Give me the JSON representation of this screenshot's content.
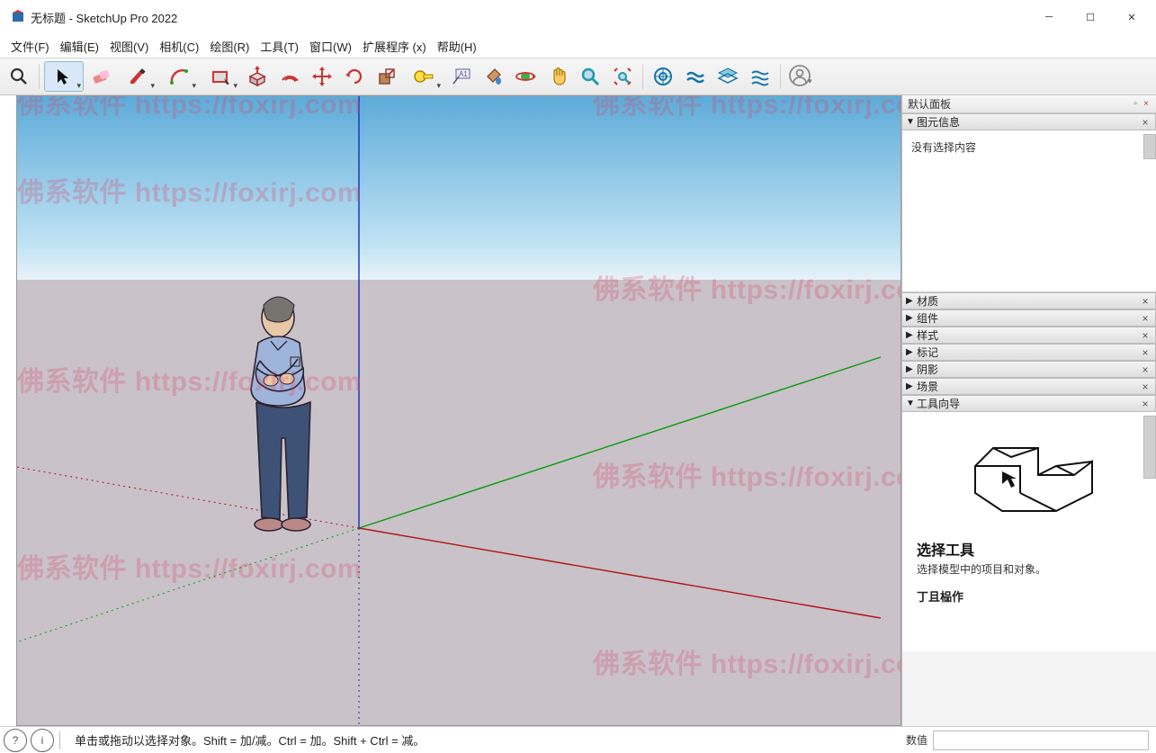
{
  "title": "无标题 - SketchUp Pro 2022",
  "menu": [
    "文件(F)",
    "编辑(E)",
    "视图(V)",
    "相机(C)",
    "绘图(R)",
    "工具(T)",
    "窗口(W)",
    "扩展程序 (x)",
    "帮助(H)"
  ],
  "toolbar": [
    {
      "name": "search-icon"
    },
    {
      "name": "select-tool",
      "active": true,
      "dropdown": true
    },
    {
      "name": "eraser-tool"
    },
    {
      "name": "pencil-tool",
      "dropdown": true
    },
    {
      "name": "arc-tool",
      "dropdown": true
    },
    {
      "name": "rectangle-tool",
      "dropdown": true
    },
    {
      "name": "pushpull-tool"
    },
    {
      "name": "offset-tool"
    },
    {
      "name": "move-tool"
    },
    {
      "name": "rotate-tool"
    },
    {
      "name": "scale-tool"
    },
    {
      "name": "tape-measure-tool",
      "dropdown": true
    },
    {
      "name": "text-tool"
    },
    {
      "name": "paint-bucket-tool"
    },
    {
      "name": "orbit-tool"
    },
    {
      "name": "pan-tool"
    },
    {
      "name": "zoom-tool"
    },
    {
      "name": "zoom-extents-tool"
    },
    {
      "name": "warehouse-tool"
    },
    {
      "name": "extension-warehouse-tool"
    },
    {
      "name": "layers-tool"
    },
    {
      "name": "outliner-tool"
    },
    {
      "name": "signin-tool"
    }
  ],
  "sidepanel": {
    "title": "默认面板",
    "sections": {
      "entity_info": {
        "label": "图元信息",
        "expanded": true,
        "body": "没有选择内容"
      },
      "materials": {
        "label": "材质",
        "expanded": false
      },
      "components": {
        "label": "组件",
        "expanded": false
      },
      "styles": {
        "label": "样式",
        "expanded": false
      },
      "tags": {
        "label": "标记",
        "expanded": false
      },
      "shadows": {
        "label": "阴影",
        "expanded": false
      },
      "scenes": {
        "label": "场景",
        "expanded": false
      },
      "instructor": {
        "label": "工具向导",
        "expanded": true
      }
    },
    "instructor": {
      "tool_title": "选择工具",
      "tool_desc": "选择模型中的项目和对象。",
      "tool_op": "丁且榀作"
    }
  },
  "status": {
    "hint": "单击或拖动以选择对象。Shift = 加/减。Ctrl = 加。Shift + Ctrl = 减。",
    "value_label": "数值",
    "value": ""
  },
  "watermark": "佛系软件 https://foxirj.com"
}
